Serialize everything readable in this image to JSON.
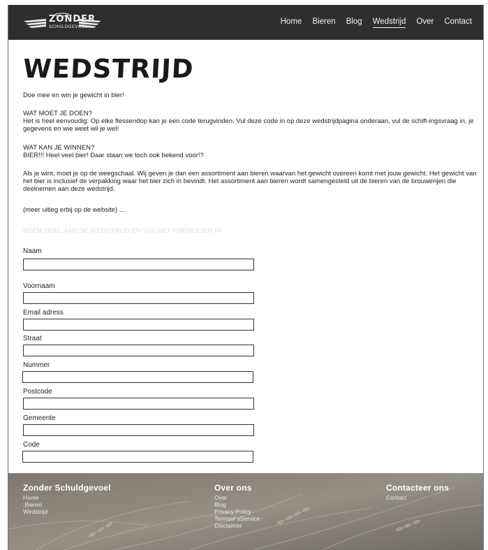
{
  "header": {
    "logo_text": "ZONDER",
    "logo_subtext": "SCHULDGEVOEL",
    "nav": [
      {
        "label": "Home",
        "active": false
      },
      {
        "label": "Bieren",
        "active": false
      },
      {
        "label": "Blog",
        "active": false
      },
      {
        "label": "Wedstrijd",
        "active": true
      },
      {
        "label": "Over",
        "active": false
      },
      {
        "label": "Contact",
        "active": false
      }
    ]
  },
  "main": {
    "title": "WEDSTRIJD",
    "intro": "Doe mee en win je gewicht in bier!",
    "how_heading": "WAT MOET JE DOEN?",
    "how_text": "Het is heel eenvoudig: Op elke flessendop kan je een code terugvinden. Vul deze code in op deze wedstrijdpagina onderaan, vul de schift-ingsvraag in, je gegevens en wie weet wil je wel!",
    "win_heading": "WAT KAN JE WINNEN?",
    "win_text": "BIER!!! Heel veel bier! Daar staan we toch ook bekend voor!?",
    "rules_text": "Als je wint, moet je op de weegschaal. Wij geven je dan een assortiment aan bieren waarvan het gewicht overeen komt met jouw gewicht. Het gewicht van het bier is inclusief de verpakking waar het bier zich in bevindt. Het assortiment aan bieren wordt samengesteld uit de bieren van de brouwerijen die deelnemen aan deze wedstrijd.",
    "more_text": "(meer uitleg erbij op de website) ...",
    "form_heading": "NEEM DEEL AAN DE WEDSTRIJD EN VUL HET FORMULIER IN"
  },
  "form": {
    "fields": [
      {
        "label": "Naam",
        "value": ""
      },
      {
        "label": "Voornaam",
        "value": ""
      },
      {
        "label": "Email adress",
        "value": ""
      },
      {
        "label": "Straat",
        "value": ""
      },
      {
        "label": "Nummer",
        "value": ""
      },
      {
        "label": "Postcode",
        "value": ""
      },
      {
        "label": "Gemeente",
        "value": ""
      },
      {
        "label": "Code",
        "value": ""
      }
    ]
  },
  "footer": {
    "col1": {
      "title": "Zonder Schuldgevoel",
      "links": [
        "Home",
        ";Bieren",
        "Wedstrijd"
      ]
    },
    "col2": {
      "title": "Over ons",
      "links": [
        "Over",
        "Blog",
        "Privacy Policy",
        "Termsof sService",
        "Disclaimer"
      ]
    },
    "col3": {
      "title": "Contacteer ons",
      "links": [
        "Contact"
      ]
    }
  },
  "colors": {
    "header_bg": "#2e2e2e",
    "footer_bg": "#8b857c",
    "form_heading": "#e0e0e0"
  }
}
